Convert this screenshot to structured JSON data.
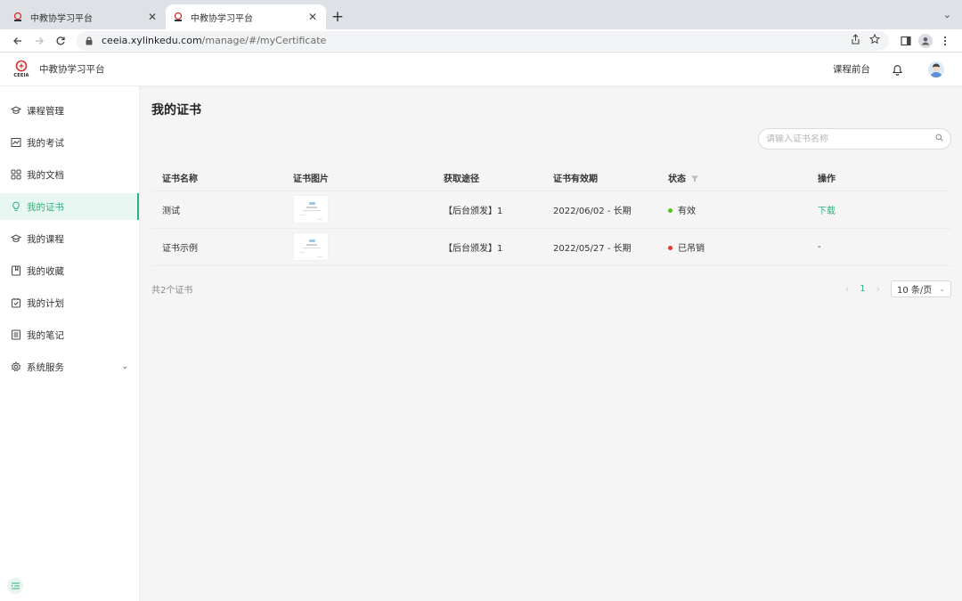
{
  "browser": {
    "tabs": [
      {
        "title": "中教协学习平台",
        "active": false
      },
      {
        "title": "中教协学习平台",
        "active": true
      }
    ],
    "url_host": "ceeia.xylinkedu.com",
    "url_path": "/manage/#/myCertificate"
  },
  "header": {
    "logo_text": "CEEIA",
    "app_title": "中教协学习平台",
    "course_front_link": "课程前台"
  },
  "sidebar": {
    "items": [
      {
        "label": "课程管理",
        "icon": "graduation-cap-icon"
      },
      {
        "label": "我的考试",
        "icon": "chart-icon"
      },
      {
        "label": "我的文档",
        "icon": "grid-icon"
      },
      {
        "label": "我的证书",
        "icon": "bulb-icon",
        "active": true
      },
      {
        "label": "我的课程",
        "icon": "graduation-cap-icon"
      },
      {
        "label": "我的收藏",
        "icon": "bookmark-icon"
      },
      {
        "label": "我的计划",
        "icon": "calendar-check-icon"
      },
      {
        "label": "我的笔记",
        "icon": "notes-icon"
      },
      {
        "label": "系统服务",
        "icon": "gear-icon",
        "expandable": true
      }
    ]
  },
  "main": {
    "page_title": "我的证书",
    "search_placeholder": "请输入证书名称",
    "table": {
      "columns": [
        "证书名称",
        "证书图片",
        "获取途径",
        "证书有效期",
        "状态",
        "操作"
      ],
      "rows": [
        {
          "name": "测试",
          "source": "【后台颁发】1",
          "validity": "2022/06/02 - 长期",
          "status": "有效",
          "status_color": "#52c41a",
          "action": "下载"
        },
        {
          "name": "证书示例",
          "source": "【后台颁发】1",
          "validity": "2022/05/27 - 长期",
          "status": "已吊销",
          "status_color": "#e53935",
          "action": "-"
        }
      ]
    },
    "total_text": "共2个证书",
    "pagination": {
      "current_page": "1",
      "page_size": "10 条/页"
    }
  },
  "colors": {
    "accent": "#2eb37c"
  }
}
